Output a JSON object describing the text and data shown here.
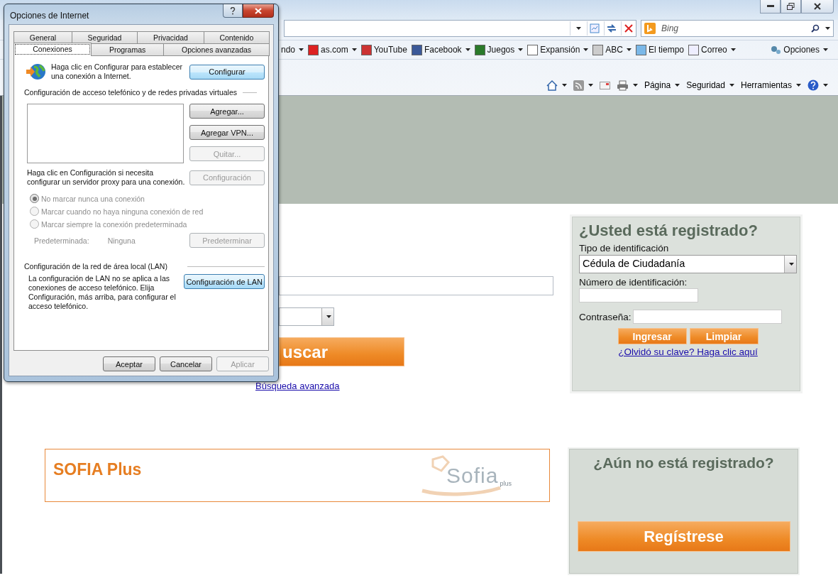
{
  "browser": {
    "search_placeholder": "Bing",
    "favorites": [
      {
        "label": "ndo",
        "has_icon": false,
        "dropdown": true
      },
      {
        "label": "as.com",
        "has_icon": true,
        "dropdown": true
      },
      {
        "label": "YouTube",
        "has_icon": true,
        "dropdown": false
      },
      {
        "label": "Facebook",
        "has_icon": true,
        "dropdown": true
      },
      {
        "label": "Juegos",
        "has_icon": true,
        "dropdown": true
      },
      {
        "label": "Expansión",
        "has_icon": true,
        "dropdown": true
      },
      {
        "label": "ABC",
        "has_icon": true,
        "dropdown": true
      },
      {
        "label": "El tiempo",
        "has_icon": true,
        "dropdown": false
      },
      {
        "label": "Correo",
        "has_icon": true,
        "dropdown": true
      }
    ],
    "options_label": "Opciones",
    "command_menus": [
      {
        "label": "Página"
      },
      {
        "label": "Seguridad"
      },
      {
        "label": "Herramientas"
      }
    ]
  },
  "dialog": {
    "title": "Opciones de Internet",
    "tabs_back_row": [
      {
        "label": "General",
        "selected": false
      },
      {
        "label": "Seguridad",
        "selected": false
      },
      {
        "label": "Privacidad",
        "selected": false
      },
      {
        "label": "Contenido",
        "selected": false
      }
    ],
    "tabs_front_row": [
      {
        "label": "Conexiones",
        "selected": true
      },
      {
        "label": "Programas",
        "selected": false
      },
      {
        "label": "Opciones avanzadas",
        "selected": false
      }
    ],
    "intro": "Haga clic en Configurar para establecer una conexión a Internet.",
    "configure_button": {
      "label": "Configurar",
      "disabled": false,
      "highlighted": true
    },
    "vpn_heading": "Configuración de acceso telefónico y de redes privadas virtuales",
    "vpn_buttons": [
      {
        "label": "Agregar...",
        "disabled": false,
        "highlighted": false
      },
      {
        "label": "Agregar VPN...",
        "disabled": false,
        "highlighted": false
      },
      {
        "label": "Quitar...",
        "disabled": true,
        "highlighted": false
      }
    ],
    "proxy_text": "Haga clic en Configuración si necesita configurar un servidor proxy para una conexión.",
    "proxy_button": {
      "label": "Configuración",
      "disabled": true,
      "highlighted": false
    },
    "radios": [
      {
        "label": "No marcar nunca una conexión",
        "selected": true,
        "disabled": true
      },
      {
        "label": "Marcar cuando no haya ninguna conexión de red",
        "selected": false,
        "disabled": true
      },
      {
        "label": "Marcar siempre la conexión predeterminada",
        "selected": false,
        "disabled": true
      }
    ],
    "default_label": "Predeterminada:",
    "default_value": "Ninguna",
    "default_button": {
      "label": "Predeterminar",
      "disabled": true,
      "highlighted": false
    },
    "lan_heading": "Configuración de la red de área local (LAN)",
    "lan_text": "La configuración de LAN no se aplica a las conexiones de acceso telefónico. Elija Configuración, más arriba, para configurar el acceso telefónico.",
    "lan_button": {
      "label": "Configuración de LAN",
      "disabled": false,
      "highlighted": true
    },
    "footer_buttons": [
      {
        "label": "Aceptar",
        "disabled": false,
        "highlighted": false
      },
      {
        "label": "Cancelar",
        "disabled": false,
        "highlighted": false
      },
      {
        "label": "Aplicar",
        "disabled": true,
        "highlighted": false
      }
    ]
  },
  "page": {
    "search_button": "uscar",
    "advanced_link": "Búsqueda avanzada",
    "login": {
      "title": "¿Usted está registrado?",
      "type_label": "Tipo de identificación",
      "type_value": "Cédula de Ciudadanía",
      "id_label": "Número de identificación:",
      "password_label": "Contraseña:",
      "buttons": [
        "Ingresar",
        "Limpiar"
      ],
      "forgot_link": "¿Olvidó su clave? Haga clic aquí"
    },
    "sofia": {
      "title": "SOFIA Plus",
      "logo_word": "Sofia",
      "logo_sub": "plus"
    },
    "register": {
      "title": "¿Aún no está registrado?",
      "button": "Regístrese"
    }
  }
}
